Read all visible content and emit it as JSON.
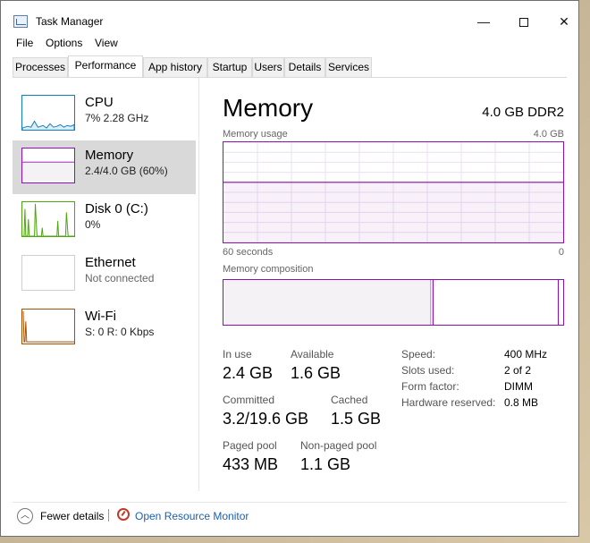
{
  "window": {
    "title": "Task Manager",
    "buttons": {
      "minimize": "—",
      "close": "✕"
    }
  },
  "menu": [
    "File",
    "Options",
    "View"
  ],
  "tabs": [
    "Processes",
    "Performance",
    "App history",
    "Startup",
    "Users",
    "Details",
    "Services"
  ],
  "active_tab": "Performance",
  "sidebar": {
    "items": [
      {
        "title": "CPU",
        "sub": "7%  2.28 GHz",
        "color": "#117dbb"
      },
      {
        "title": "Memory",
        "sub": "2.4/4.0 GB (60%)",
        "color": "#8b12ae",
        "selected": true
      },
      {
        "title": "Disk 0 (C:)",
        "sub": "0%",
        "color": "#4da60c"
      },
      {
        "title": "Ethernet",
        "sub": "Not connected",
        "color": "#a74f01"
      },
      {
        "title": "Wi-Fi",
        "sub": "S: 0  R: 0 Kbps",
        "color": "#a74f01"
      }
    ]
  },
  "main": {
    "title": "Memory",
    "spec": "4.0 GB DDR2",
    "usage_label": "Memory usage",
    "usage_max": "4.0 GB",
    "time_left": "60 seconds",
    "time_right": "0",
    "composition_label": "Memory composition",
    "usage_fraction": 0.6,
    "stats": {
      "in_use_label": "In use",
      "in_use": "2.4 GB",
      "available_label": "Available",
      "available": "1.6 GB",
      "committed_label": "Committed",
      "committed": "3.2/19.6 GB",
      "cached_label": "Cached",
      "cached": "1.5 GB",
      "paged_label": "Paged pool",
      "paged": "433 MB",
      "nonpaged_label": "Non-paged pool",
      "nonpaged": "1.1 GB"
    },
    "specs": {
      "speed_label": "Speed:",
      "speed": "400 MHz",
      "slots_label": "Slots used:",
      "slots": "2 of 2",
      "form_label": "Form factor:",
      "form": "DIMM",
      "reserved_label": "Hardware reserved:",
      "reserved": "0.8 MB"
    }
  },
  "footer": {
    "fewer_details": "Fewer details",
    "resource_monitor": "Open Resource Monitor"
  },
  "colors": {
    "memory": "#8b12ae",
    "cpu": "#117dbb",
    "disk": "#4da60c",
    "network": "#a74f01",
    "link": "#1a5fb4"
  }
}
